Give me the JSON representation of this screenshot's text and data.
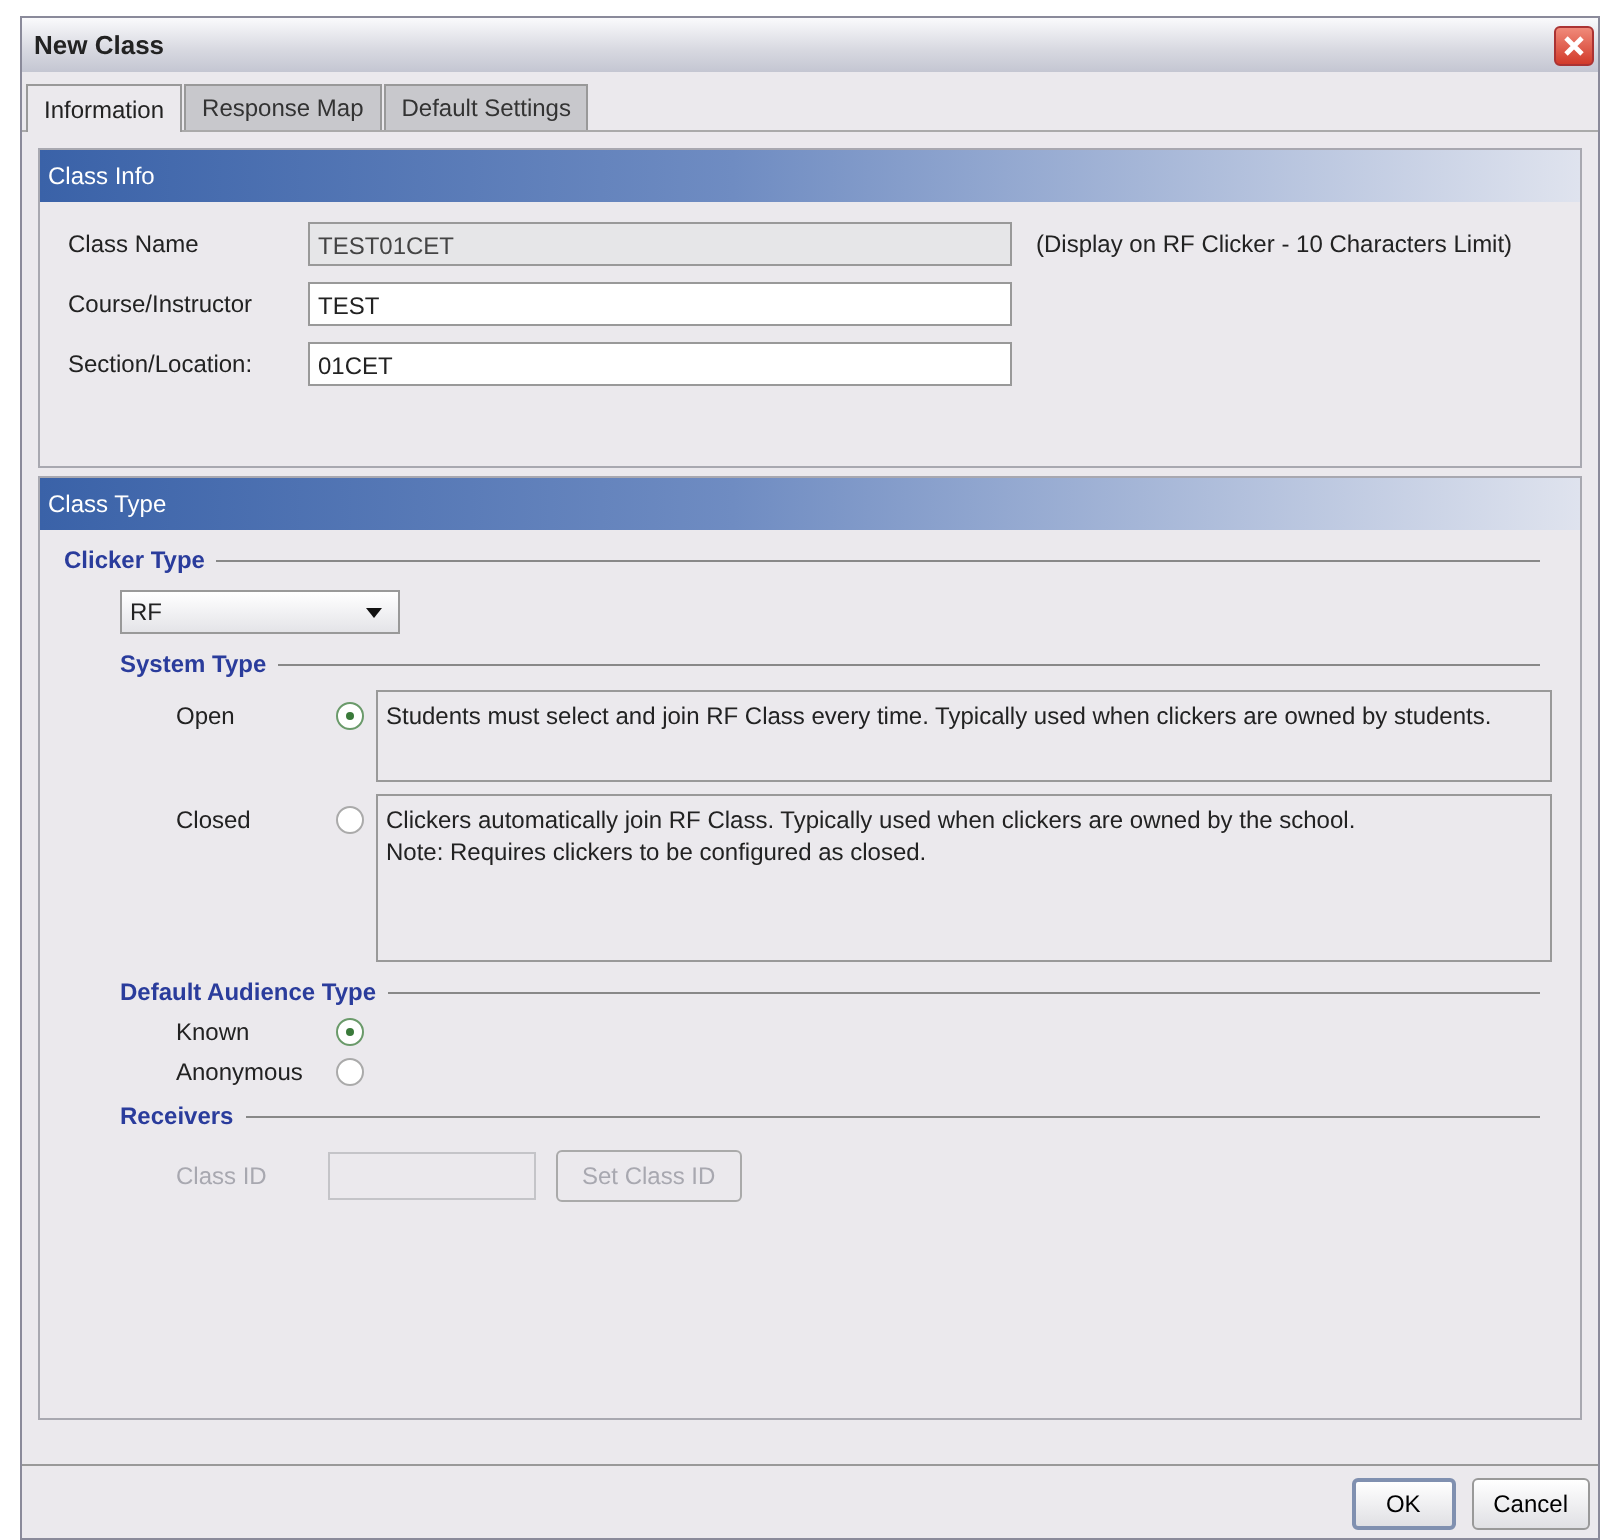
{
  "window": {
    "title": "New Class"
  },
  "tabs": [
    {
      "label": "Information",
      "selected": true
    },
    {
      "label": "Response Map",
      "selected": false
    },
    {
      "label": "Default Settings",
      "selected": false
    }
  ],
  "class_info": {
    "header": "Class Info",
    "fields": [
      {
        "label": "Class Name",
        "value": "TEST01CET",
        "disabled": true
      },
      {
        "label": "Course/Instructor",
        "value": "TEST",
        "disabled": false
      },
      {
        "label": "Section/Location:",
        "value": "01CET",
        "disabled": false
      }
    ],
    "note": "(Display on RF Clicker - 10 Characters Limit)"
  },
  "class_type": {
    "header": "Class Type",
    "clicker_type": {
      "legend": "Clicker Type",
      "value": "RF"
    },
    "system_type": {
      "legend": "System Type",
      "options": [
        {
          "label": "Open",
          "description": "Students must select and join RF Class every time. Typically used when clickers are owned by students.",
          "selected": true
        },
        {
          "label": "Closed",
          "description": "Clickers automatically join RF Class. Typically used when clickers are owned by the school.\nNote: Requires clickers to be configured as closed.",
          "selected": false
        }
      ]
    },
    "audience_type": {
      "legend": "Default Audience Type",
      "options": [
        {
          "label": "Known",
          "selected": true
        },
        {
          "label": "Anonymous",
          "selected": false
        }
      ]
    },
    "receivers": {
      "legend": "Receivers",
      "disabled": true,
      "class_id_label": "Class ID",
      "button": "Set Class ID"
    }
  },
  "buttons": [
    {
      "label": "OK",
      "default": true
    },
    {
      "label": "Cancel",
      "default": false
    }
  ]
}
